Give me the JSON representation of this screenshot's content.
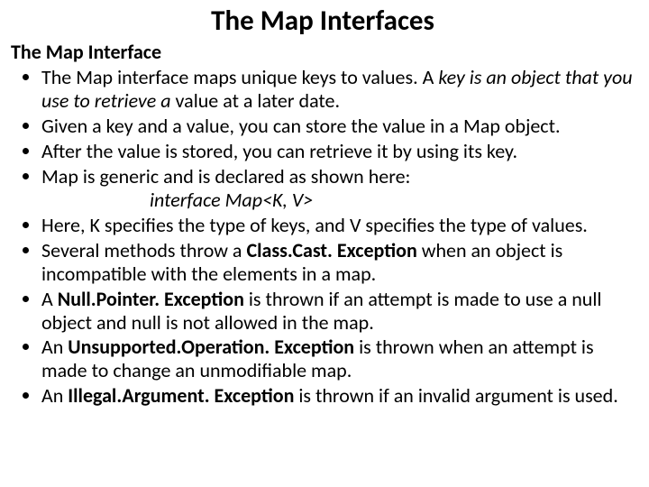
{
  "title": "The Map Interfaces",
  "subtitle": "The Map Interface",
  "bullets": {
    "b1_a": "The Map interface maps unique keys to values. A ",
    "b1_b": "key is an object that you use to retrieve a",
    "b1_c": " value at a later date.",
    "b2": "Given a key and a value, you can store the value in a Map object.",
    "b3": "After the value is stored, you can retrieve it by using its key.",
    "b4": "Map is generic and is declared as shown here:",
    "code": "interface Map<K, V>",
    "b5": "Here, K specifies the type of keys, and V specifies the type of values.",
    "b6_a": "Several methods throw a ",
    "b6_b": "Class.Cast. Exception",
    "b6_c": " when an object is incompatible with the elements in a map.",
    "b7_a": "A ",
    "b7_b": "Null.Pointer. Exception",
    "b7_c": " is thrown if an attempt is made to use a null object and null is not allowed in the map.",
    "b8_a": "An ",
    "b8_b": "Unsupported.Operation. Exception",
    "b8_c": " is thrown when an attempt is made to change an unmodifiable map.",
    "b9_a": "An ",
    "b9_b": "Illegal.Argument. Exception",
    "b9_c": " is thrown if an invalid argument is used."
  }
}
